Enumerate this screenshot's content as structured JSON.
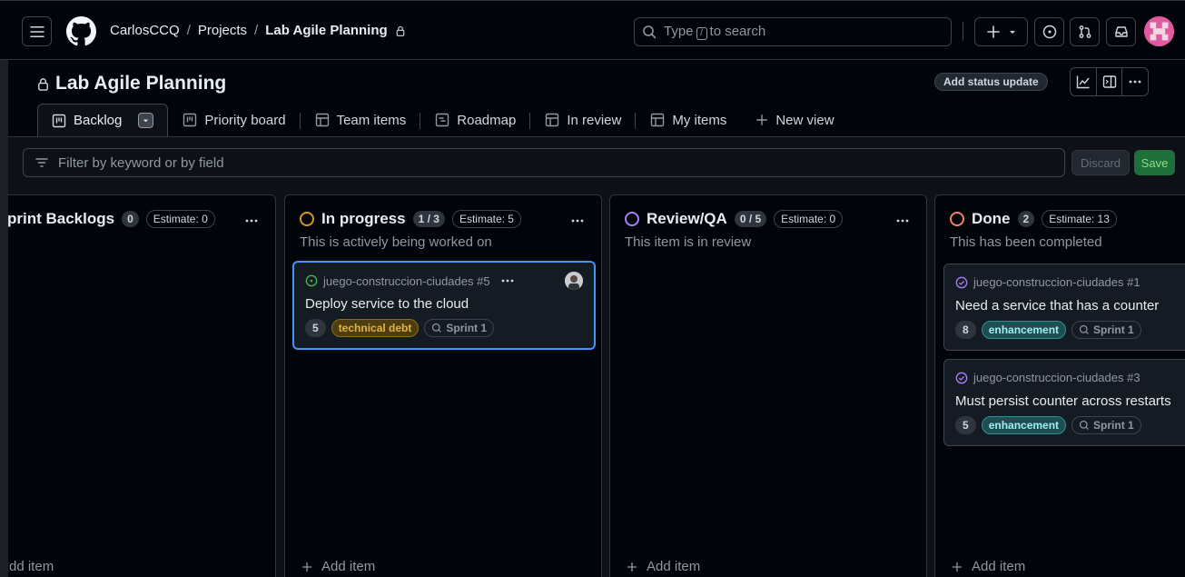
{
  "header": {
    "owner": "CarlosCCQ",
    "section": "Projects",
    "project": "Lab Agile Planning",
    "search_before": "Type",
    "search_key": "/",
    "search_after": "to search"
  },
  "project": {
    "title": "Lab Agile Planning",
    "status_button": "Add status update"
  },
  "tabs": [
    {
      "label": "Backlog",
      "icon": "board-icon"
    },
    {
      "label": "Priority board",
      "icon": "board-icon"
    },
    {
      "label": "Team items",
      "icon": "table-icon"
    },
    {
      "label": "Roadmap",
      "icon": "roadmap-icon"
    },
    {
      "label": "In review",
      "icon": "table-icon"
    },
    {
      "label": "My items",
      "icon": "table-icon"
    },
    {
      "label": "New view",
      "icon": "plus-icon"
    }
  ],
  "filter": {
    "placeholder": "Filter by keyword or by field",
    "discard": "Discard",
    "save": "Save"
  },
  "columns": [
    {
      "name": "Sprint Backlogs",
      "visible_name": "print Backlogs",
      "count": "0",
      "estimate": "Estimate: 0",
      "description": "",
      "add_item": "dd item",
      "color": "#e6edf3"
    },
    {
      "name": "In progress",
      "count": "1 / 3",
      "estimate": "Estimate: 5",
      "description": "This is actively being worked on",
      "add_item": "Add item",
      "color": "#d29922"
    },
    {
      "name": "Review/QA",
      "count": "0 / 5",
      "estimate": "Estimate: 0",
      "description": "This item is in review",
      "add_item": "Add item",
      "color": "#ab7df8"
    },
    {
      "name": "Done",
      "count": "2",
      "estimate": "Estimate: 13",
      "description": "This has been completed",
      "add_item": "Add item",
      "color": "#f78166"
    }
  ],
  "cards": {
    "progress": {
      "repo": "juego-construccion-ciudades #5",
      "title": "Deploy service to the cloud",
      "estimate": "5",
      "label": "technical debt",
      "iteration": "Sprint 1",
      "status_color": "#3fb950"
    },
    "done1": {
      "repo": "juego-construccion-ciudades #1",
      "title": "Need a service that has a counter",
      "estimate": "8",
      "label": "enhancement",
      "iteration": "Sprint 1",
      "status_color": "#ab7df8"
    },
    "done2": {
      "repo": "juego-construccion-ciudades #3",
      "title": "Must persist counter across restarts",
      "estimate": "5",
      "label": "enhancement",
      "iteration": "Sprint 1",
      "status_color": "#ab7df8"
    }
  }
}
